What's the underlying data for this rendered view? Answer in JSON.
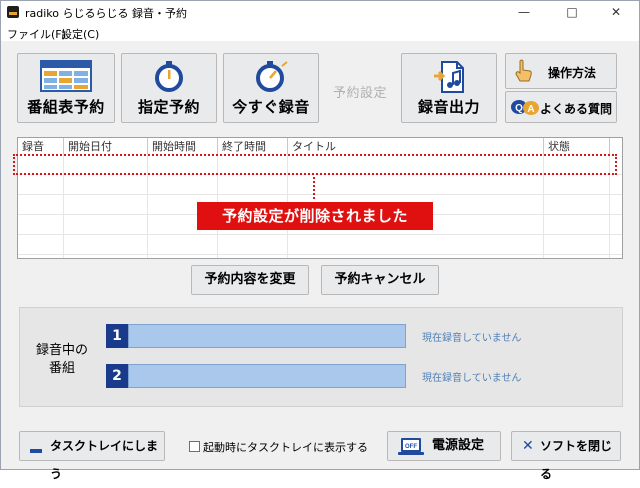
{
  "window": {
    "title": "radiko らじるらじる 録音・予約",
    "minimize": "—",
    "maximize": "□",
    "close": "✕"
  },
  "menu": {
    "file": "ファイル(F)",
    "settings": "設定(C)"
  },
  "toolbar": {
    "program_table_reserve": "番組表予約",
    "specified_reserve": "指定予約",
    "record_now": "今すぐ録音",
    "reserve_settings": "予約設定",
    "record_output": "録音出力",
    "how_to_use": "操作方法",
    "faq": "よくある質問"
  },
  "list": {
    "columns": [
      "録音",
      "開始日付",
      "開始時間",
      "終了時間",
      "タイトル",
      "状態"
    ],
    "rows": []
  },
  "callout": {
    "message": "予約設定が削除されました"
  },
  "actions": {
    "change": "予約内容を変更",
    "cancel": "予約キャンセル"
  },
  "recording": {
    "label_line1": "録音中の",
    "label_line2": "番組",
    "slots": [
      {
        "number": "1",
        "status": "現在録音していません"
      },
      {
        "number": "2",
        "status": "現在録音していません"
      }
    ]
  },
  "bottom": {
    "to_tray": "タスクトレイにしまう",
    "show_in_tray_on_start": "起動時にタスクトレイに表示する",
    "power_settings": "電源設定",
    "close_app": "ソフトを閉じる"
  },
  "colors": {
    "accent_red": "#e01010",
    "slot_blue": "#1a3a8c",
    "bar_blue": "#a9c8eb"
  }
}
